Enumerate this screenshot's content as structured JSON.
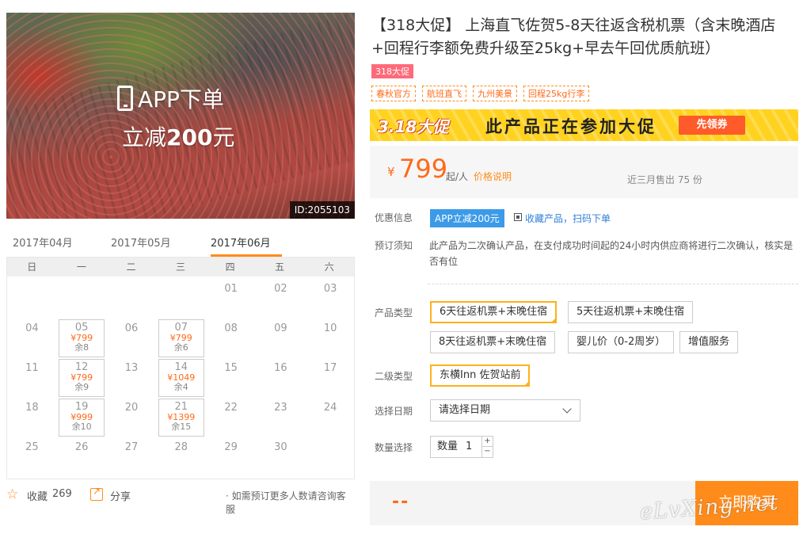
{
  "hero": {
    "banner_line1": "APP下单",
    "banner_line2_prefix": "立减",
    "banner_line2_amount": "200",
    "banner_line2_suffix": "元",
    "product_id": "ID:2055103"
  },
  "calendar": {
    "months": [
      "2017年04月",
      "2017年05月",
      "2017年06月"
    ],
    "active_month": "2017年06月",
    "weekdays": [
      "日",
      "一",
      "二",
      "三",
      "四",
      "五",
      "六"
    ],
    "days": [
      {
        "d": "01"
      },
      {
        "d": "02"
      },
      {
        "d": "03"
      },
      {
        "d": "04"
      },
      {
        "d": "05",
        "price": "¥799",
        "remain": "余8"
      },
      {
        "d": "06"
      },
      {
        "d": "07",
        "price": "¥799",
        "remain": "余6"
      },
      {
        "d": "08"
      },
      {
        "d": "09"
      },
      {
        "d": "10"
      },
      {
        "d": "11"
      },
      {
        "d": "12",
        "price": "¥799",
        "remain": "余9"
      },
      {
        "d": "13"
      },
      {
        "d": "14",
        "price": "¥1049",
        "remain": "余4"
      },
      {
        "d": "15"
      },
      {
        "d": "16"
      },
      {
        "d": "17"
      },
      {
        "d": "18"
      },
      {
        "d": "19",
        "price": "¥999",
        "remain": "余10"
      },
      {
        "d": "20"
      },
      {
        "d": "21",
        "price": "¥1399",
        "remain": "余15"
      },
      {
        "d": "22"
      },
      {
        "d": "23"
      },
      {
        "d": "24"
      },
      {
        "d": "25"
      },
      {
        "d": "26"
      },
      {
        "d": "27"
      },
      {
        "d": "28"
      },
      {
        "d": "29"
      },
      {
        "d": "30"
      }
    ]
  },
  "actions": {
    "favorite_label": "收藏",
    "favorite_count": "269",
    "share_label": "分享",
    "consult_note": "· 如需预订更多人数请咨询客服"
  },
  "product": {
    "title": "【318大促】 上海直飞佐贺5-8天往返含税机票（含末晚酒店+回程行李额免费升级至25kg+早去午回优质航班）",
    "promo_badge": "318大促",
    "tags": [
      "春秋官方",
      "航班直飞",
      "九州美景",
      "回程25kg行李"
    ]
  },
  "promo_strip": {
    "sale_label": "3.18大促",
    "message": "此产品正在参加大促",
    "coupon_button": "先领券"
  },
  "price": {
    "currency": "¥",
    "value": "799",
    "unit": "起/人",
    "note_link": "价格说明",
    "sold_text": "近三月售出 75 份"
  },
  "offers": {
    "label": "优惠信息",
    "app_badge": "APP立减200元",
    "qr_link": "收藏产品，扫码下单"
  },
  "booking_notice": {
    "label": "预订须知",
    "text": "此产品为二次确认产品，在支付成功时间起的24小时内供应商将进行二次确认，核实是否有位"
  },
  "product_type": {
    "label": "产品类型",
    "options": [
      "6天往返机票+末晚住宿",
      "5天往返机票+末晚住宿",
      "8天往返机票+末晚住宿",
      "婴儿价（0-2周岁）",
      "增值服务"
    ],
    "selected": "6天往返机票+末晚住宿"
  },
  "sub_type": {
    "label": "二级类型",
    "options": [
      "东横Inn 佐贺站前"
    ],
    "selected": "东横Inn 佐贺站前"
  },
  "date": {
    "label": "选择日期",
    "placeholder": "请选择日期"
  },
  "quantity": {
    "label": "数量选择",
    "field_label": "数量",
    "value": "1",
    "plus": "+",
    "minus": "−"
  },
  "buy": {
    "total_placeholder": "--",
    "button": "立即购买"
  },
  "watermark": "eLvXing.net",
  "colors": {
    "accent_orange": "#ff8c1a",
    "price_orange": "#ff6a1a",
    "badge_blue": "#3c9be8",
    "promo_yellow": "#ffd21f"
  }
}
